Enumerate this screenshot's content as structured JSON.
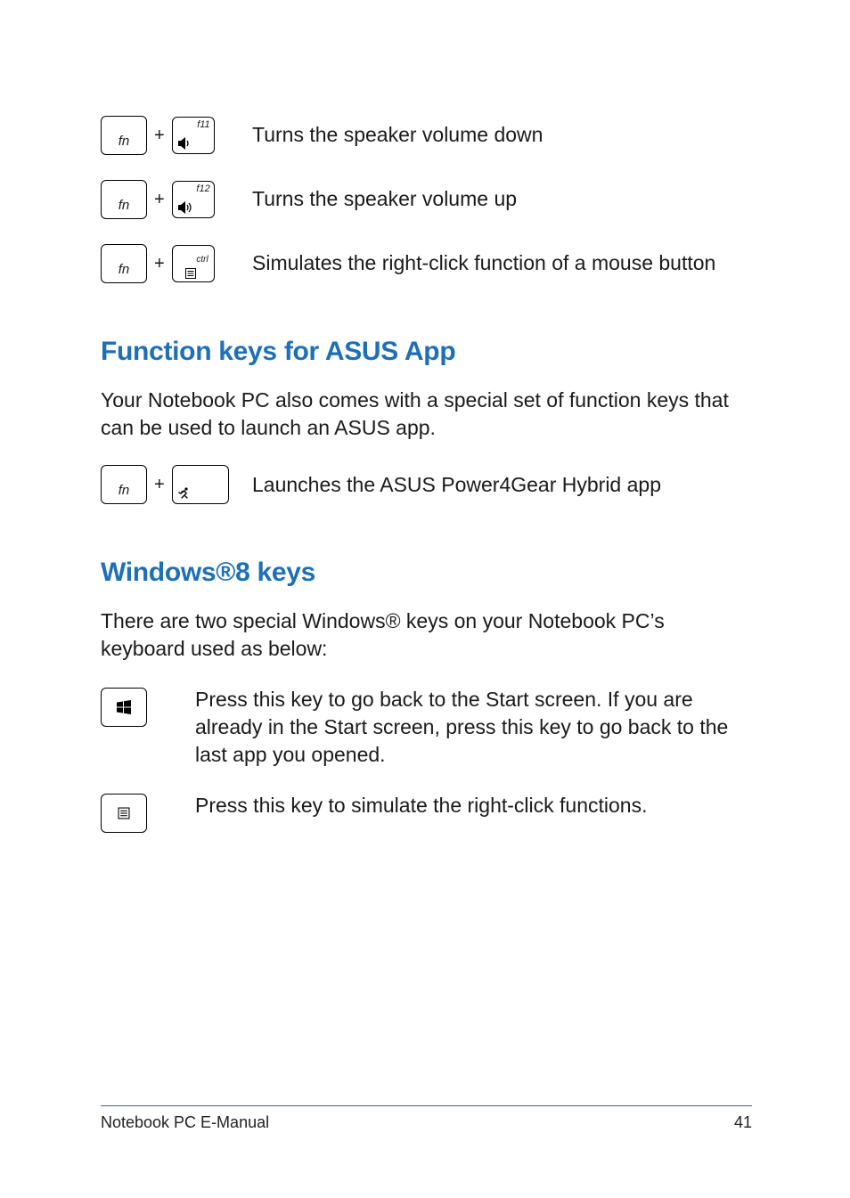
{
  "rows_top": [
    {
      "name": "fn-f11-volume-down",
      "fn": "fn",
      "fkey": "f11",
      "desc": "Turns the speaker volume down",
      "icon": "volume-down-icon"
    },
    {
      "name": "fn-f12-volume-up",
      "fn": "fn",
      "fkey": "f12",
      "desc": "Turns the speaker volume up",
      "icon": "volume-up-icon"
    },
    {
      "name": "fn-ctrl-right-click",
      "fn": "fn",
      "fkey": "ctrl",
      "desc": "Simulates the right-click function of a mouse button",
      "icon": "context-menu-icon"
    }
  ],
  "section_asus": {
    "heading": "Function keys for ASUS App",
    "body": "Your Notebook PC also comes with a special set of function keys that can be used to launch an ASUS app.",
    "row": {
      "name": "fn-space-power4gear",
      "fn": "fn",
      "desc": "Launches the ASUS Power4Gear Hybrid app",
      "icon": "runner-icon"
    }
  },
  "section_win": {
    "heading": "Windows®8 keys",
    "body": "There are two special Windows® keys on your Notebook PC’s keyboard used as below:",
    "rows": [
      {
        "name": "windows-key-start",
        "icon": "windows-logo-icon",
        "desc": "Press this key to go back to the Start screen. If you are already in the Start screen, press this key to go back to the last app you opened."
      },
      {
        "name": "menu-key-right-click",
        "icon": "context-menu-icon",
        "desc": "Press this key to simulate the right-click functions."
      }
    ]
  },
  "footer": {
    "title": "Notebook PC E-Manual",
    "page": "41"
  },
  "key_labels": {
    "fn": "fn",
    "f11": "f11",
    "f12": "f12",
    "ctrl": "ctrl"
  },
  "plus": "+"
}
